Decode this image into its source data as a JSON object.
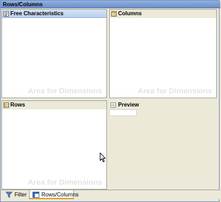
{
  "window": {
    "title": "Rows/Columns"
  },
  "panes": {
    "free_characteristics": {
      "title": "Free Characteristics",
      "hint": "Area for Dimensions",
      "icon": "characteristics-list-icon"
    },
    "columns": {
      "title": "Columns",
      "hint": "Area for Dimensions",
      "icon": "columns-icon"
    },
    "rows": {
      "title": "Rows",
      "hint": "Area for Dimensions",
      "icon": "rows-icon"
    },
    "preview": {
      "title": "Preview",
      "icon": "preview-grid-icon"
    }
  },
  "tabs": [
    {
      "label": "Filter",
      "icon": "filter-funnel-icon",
      "active": false
    },
    {
      "label": "Rows/Columns",
      "icon": "rows-columns-icon",
      "active": true
    }
  ],
  "colors": {
    "active_header": "#b9cfee",
    "title_bar": "#6d8fc6",
    "tab_accent": "#e8a030"
  }
}
